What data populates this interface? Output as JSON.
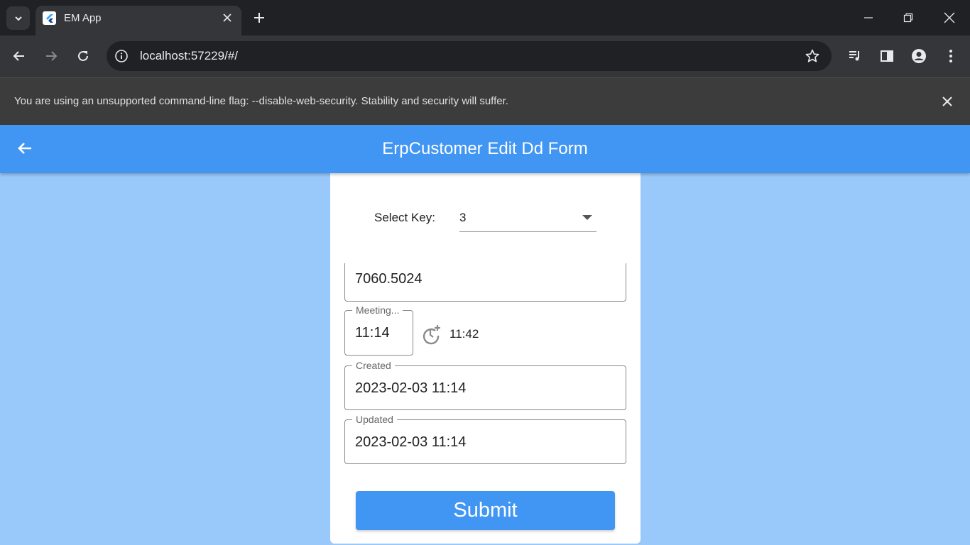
{
  "browser": {
    "tab_title": "EM App",
    "url": "localhost:57229/#/",
    "infobar_text": "You are using an unsupported command-line flag: --disable-web-security. Stability and security will suffer."
  },
  "app": {
    "title": "ErpCustomer Edit Dd Form",
    "colors": {
      "appbar": "#4196f3",
      "background": "#99c9fa",
      "button": "#4196f3"
    }
  },
  "form": {
    "select_label": "Select Key:",
    "select_value": "3",
    "top_field_value": "7060.5024",
    "meeting_label": "Meeting...",
    "meeting_value": "11:14",
    "meeting_end": "11:42",
    "created_label": "Created",
    "created_value": "2023-02-03 11:14",
    "updated_label": "Updated",
    "updated_value": "2023-02-03 11:14",
    "submit_label": "Submit"
  }
}
